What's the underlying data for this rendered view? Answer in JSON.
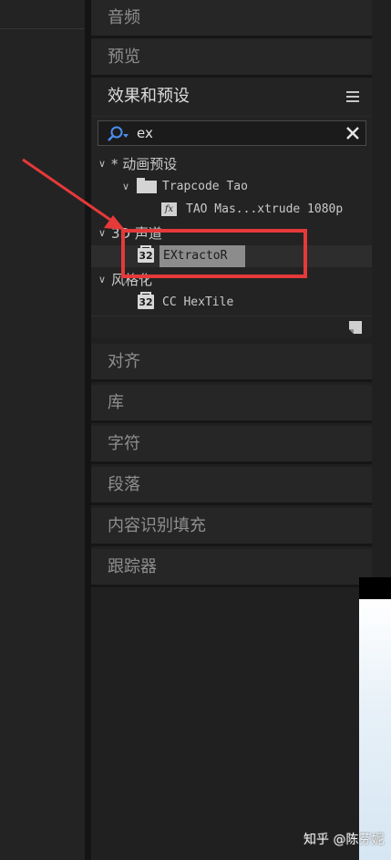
{
  "panels_top": {
    "audio": "音频",
    "preview": "预览",
    "effects_presets": "效果和预设"
  },
  "search": {
    "value": "ex"
  },
  "tree": {
    "presets_group": "* 动画预设",
    "trapcode_folder": "Trapcode Tao",
    "tao_preset": "TAO Mas...xtrude 1080p",
    "channel_3d_group": "3D 声道",
    "extractor_effect": "EXtractoR",
    "stylize_group": "风格化",
    "hextile_effect": "CC HexTile",
    "badge_32": "32",
    "fx_badge": "fx"
  },
  "panels_bottom": {
    "align": "对齐",
    "library": "库",
    "character": "字符",
    "paragraph": "段落",
    "content_aware_fill": "内容识别填充",
    "tracker": "跟踪器"
  },
  "watermark": "知乎 @陈芬妮",
  "colors": {
    "annotation_red": "#e5393a",
    "panel_bg": "#232323",
    "selected_row": "#2d2d2d"
  },
  "icons": [
    "search-icon",
    "clear-icon",
    "panel-menu-icon",
    "folder-icon",
    "fx-preset-icon",
    "32bit-effect-icon",
    "new-bin-icon"
  ]
}
